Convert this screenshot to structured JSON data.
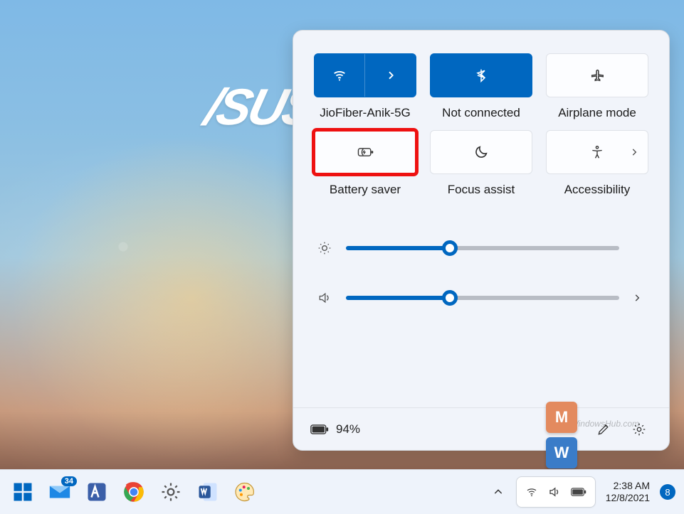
{
  "logo_text": "/SUS",
  "quick_settings": {
    "wifi": {
      "label": "JioFiber-Anik-5G",
      "active": true,
      "has_arrow": true
    },
    "bluetooth": {
      "label": "Not connected",
      "active": true,
      "has_arrow": false
    },
    "airplane": {
      "label": "Airplane mode",
      "active": false,
      "has_arrow": false
    },
    "battery_saver": {
      "label": "Battery saver",
      "active": false,
      "highlighted": true
    },
    "focus": {
      "label": "Focus assist",
      "active": false,
      "has_arrow": false
    },
    "accessibility": {
      "label": "Accessibility",
      "active": false,
      "has_arrow": true
    }
  },
  "sliders": {
    "brightness": {
      "percent": 38
    },
    "volume": {
      "percent": 38
    }
  },
  "footer": {
    "battery_percent": "94%"
  },
  "watermark": {
    "top_letter": "M",
    "bottom_letter": "W",
    "text": "MyWindowsHub.com"
  },
  "taskbar": {
    "mail_badge": "34",
    "time": "2:38 AM",
    "date": "12/8/2021",
    "notification_count": "8"
  }
}
